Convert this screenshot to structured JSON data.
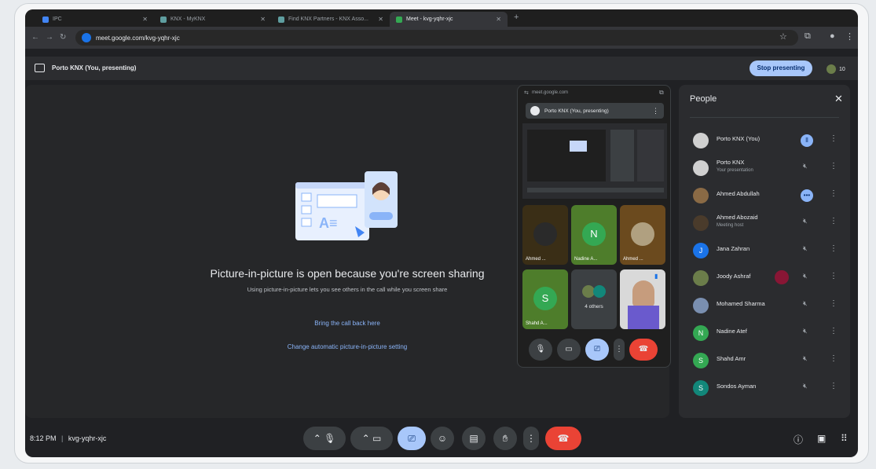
{
  "browser": {
    "tabs": [
      {
        "label": "IPC"
      },
      {
        "label": "KNX - MyKNX"
      },
      {
        "label": "Find KNX Partners - KNX Asso..."
      },
      {
        "label": "Meet - kvg-yqhr-xjc"
      }
    ],
    "url": "meet.google.com/kvg-yqhr-xjc"
  },
  "presenting_bar": {
    "title": "Porto KNX (You, presenting)",
    "stop_label": "Stop presenting",
    "participant_count": "10"
  },
  "stage": {
    "title": "Picture-in-picture is open because you're screen sharing",
    "subtitle": "Using picture-in-picture lets you see others in the call while you screen share",
    "link_back": "Bring the call back here",
    "link_setting": "Change automatic picture-in-picture setting"
  },
  "pip": {
    "url": "meet.google.com",
    "header": "Porto KNX (You, presenting)",
    "tiles": [
      {
        "name": "Ahmed ...",
        "initial": "",
        "color": "#3a2e16"
      },
      {
        "name": "Nadine A...",
        "initial": "N",
        "color": "#4e7d2b"
      },
      {
        "name": "Ahmed ...",
        "initial": "",
        "color": "#6b4a1e"
      },
      {
        "name": "Shahd A...",
        "initial": "S",
        "color": "#4e7d2b"
      },
      {
        "name": "4 others",
        "initial": "",
        "color": "#3c4043"
      },
      {
        "name": "",
        "initial": "",
        "color": "#d9d9d9"
      }
    ]
  },
  "people": {
    "title": "People",
    "participants": [
      {
        "name": "Porto KNX (You)",
        "sub": "",
        "initial": "",
        "color": "#d0d0d0",
        "mic": "on"
      },
      {
        "name": "Porto KNX",
        "sub": "Your presentation",
        "initial": "",
        "color": "#d0d0d0",
        "mic": "off"
      },
      {
        "name": "Ahmed Abdullah",
        "sub": "",
        "initial": "",
        "color": "#8a6a45",
        "mic": "on"
      },
      {
        "name": "Ahmed Abozaid",
        "sub": "Meeting host",
        "initial": "",
        "color": "#4a3b2b",
        "mic": "off"
      },
      {
        "name": "Jana Zahran",
        "sub": "",
        "initial": "J",
        "color": "#1a73e8",
        "mic": "off"
      },
      {
        "name": "Joody Ashraf",
        "sub": "",
        "initial": "",
        "color": "#6b7d4a",
        "mic": "off"
      },
      {
        "name": "Mohamed Sharma",
        "sub": "",
        "initial": "",
        "color": "#7a8fb0",
        "mic": "off"
      },
      {
        "name": "Nadine Atef",
        "sub": "",
        "initial": "N",
        "color": "#34a853",
        "mic": "off"
      },
      {
        "name": "Shahd Amr",
        "sub": "",
        "initial": "S",
        "color": "#34a853",
        "mic": "off"
      },
      {
        "name": "Sondos Ayman",
        "sub": "",
        "initial": "S",
        "color": "#12877a",
        "mic": "off"
      }
    ]
  },
  "bottom": {
    "time": "8:12 PM",
    "separator": "|",
    "code": "kvg-yqhr-xjc"
  },
  "colors": {
    "accent": "#a8c7fa",
    "end_call": "#ea4335",
    "link": "#8ab4f8"
  }
}
